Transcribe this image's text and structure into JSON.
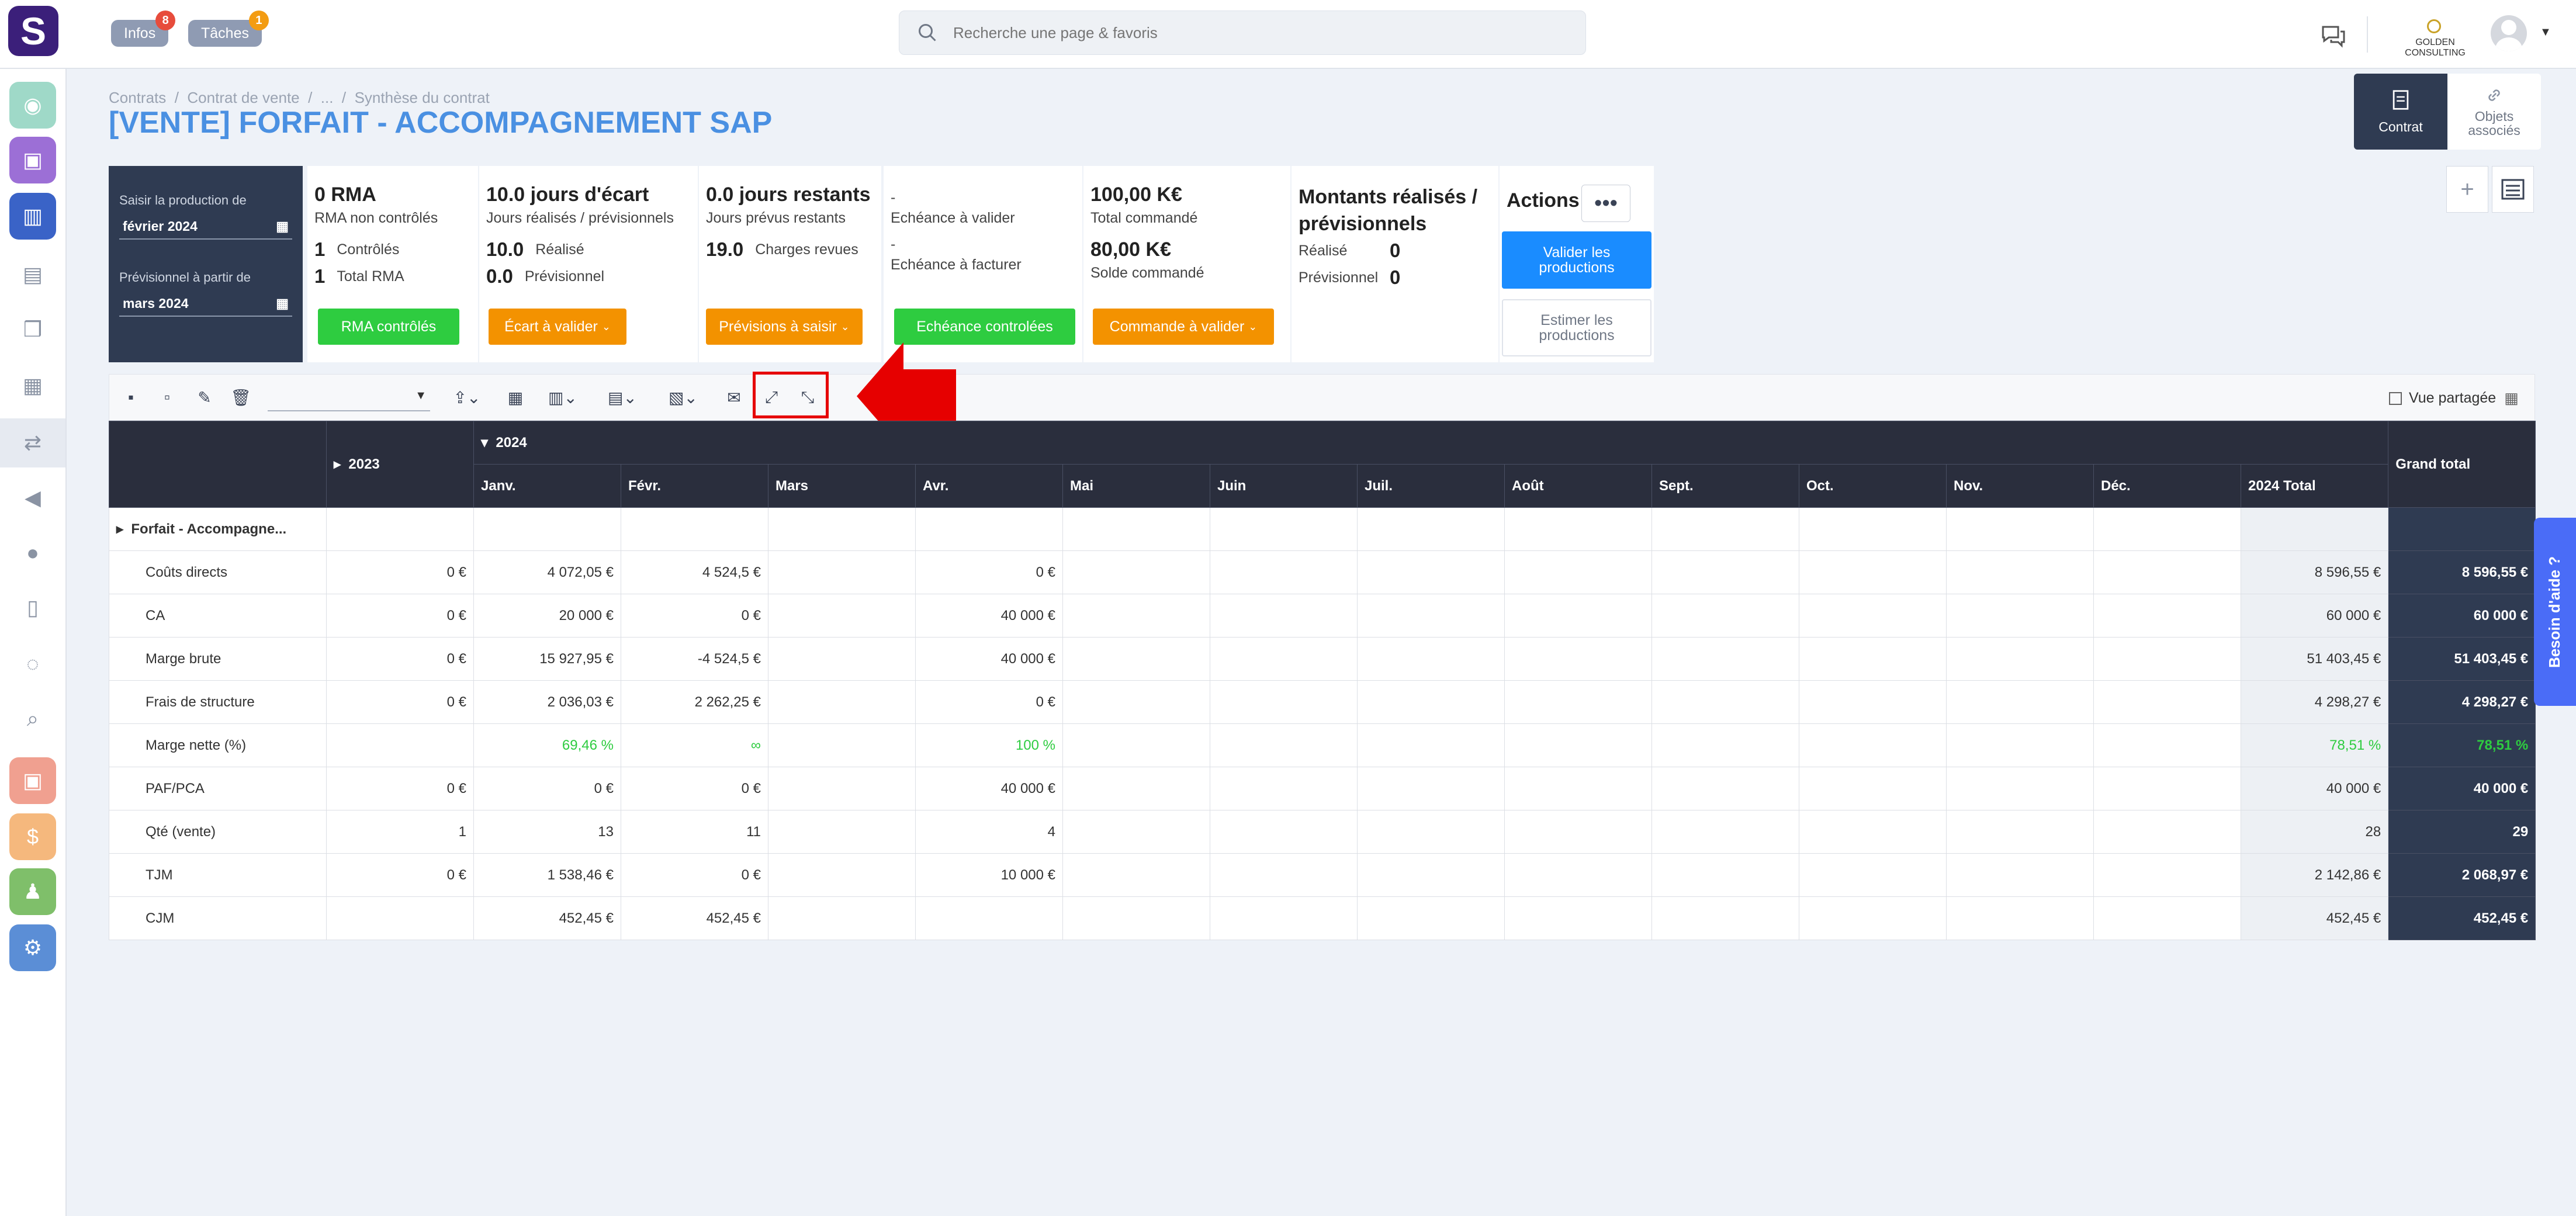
{
  "app": {
    "logo_letter": "S"
  },
  "topbar": {
    "infos_label": "Infos",
    "infos_count": "8",
    "taches_label": "Tâches",
    "taches_count": "1",
    "search_placeholder": "Recherche une page & favoris",
    "company": "GOLDEN CONSULTING"
  },
  "breadcrumb": [
    "Contrats",
    "/",
    "Contrat de vente",
    "/",
    "...",
    "/",
    "Synthèse du contrat"
  ],
  "page_title": "[VENTE] FORFAIT - ACCOMPAGNEMENT SAP",
  "view_tabs": {
    "contrat": "Contrat",
    "objets": "Objets associés"
  },
  "saisie": {
    "label1": "Saisir la production de",
    "value1": "février 2024",
    "label2": "Prévisionnel à partir de",
    "value2": "mars 2024"
  },
  "kpi": {
    "rma": {
      "title": "0 RMA",
      "sub": "RMA non contrôlés",
      "r1n": "1",
      "r1t": "Contrôlés",
      "r2n": "1",
      "r2t": "Total RMA",
      "btn": "RMA contrôlés"
    },
    "ecart": {
      "title": "10.0 jours d'écart",
      "sub": "Jours réalisés / prévisionnels",
      "r1n": "10.0",
      "r1t": "Réalisé",
      "r2n": "0.0",
      "r2t": "Prévisionnel",
      "btn": "Écart à valider"
    },
    "restants": {
      "title": "0.0 jours restants",
      "sub": "Jours prévus restants",
      "r1n": "19.0",
      "r1t": "Charges revues",
      "btn": "Prévisions à saisir"
    },
    "echeance": {
      "d1": "-",
      "l1": "Echéance à valider",
      "d2": "-",
      "l2": "Echéance à facturer",
      "btn": "Echéance controlées"
    },
    "commande": {
      "title": "100,00 K€",
      "sub": "Total commandé",
      "title2": "80,00 K€",
      "sub2": "Solde commandé",
      "btn": "Commande à valider"
    },
    "montants": {
      "title": "Montants réalisés / prévisionnels",
      "r1t": "Réalisé",
      "r1n": "0",
      "r2t": "Prévisionnel",
      "r2n": "0"
    },
    "actions": {
      "title": "Actions",
      "btn1": "Valider les productions",
      "btn2": "Estimer les productions"
    }
  },
  "toolbar": {
    "vue_partagee": "Vue partagée"
  },
  "table": {
    "year2023": "2023",
    "year2024": "2024",
    "months": [
      "Janv.",
      "Févr.",
      "Mars",
      "Avr.",
      "Mai",
      "Juin",
      "Juil.",
      "Août",
      "Sept.",
      "Oct.",
      "Nov.",
      "Déc."
    ],
    "total2024": "2024 Total",
    "grand_total": "Grand total",
    "group": "Forfait - Accompagne...",
    "rows": [
      {
        "label": "Coûts directs",
        "y2023": "0 €",
        "janv": "4 072,05 €",
        "fevr": "4 524,5 €",
        "mars": "",
        "avr": "0 €",
        "tot": "8 596,55 €",
        "gt": "8 596,55 €"
      },
      {
        "label": "CA",
        "y2023": "0 €",
        "janv": "20 000 €",
        "fevr": "0 €",
        "mars": "",
        "avr": "40 000 €",
        "tot": "60 000 €",
        "gt": "60 000 €"
      },
      {
        "label": "Marge brute",
        "y2023": "0 €",
        "janv": "15 927,95 €",
        "fevr": "-4 524,5 €",
        "mars": "",
        "avr": "40 000 €",
        "tot": "51 403,45 €",
        "gt": "51 403,45 €"
      },
      {
        "label": "Frais de structure",
        "y2023": "0 €",
        "janv": "2 036,03 €",
        "fevr": "2 262,25 €",
        "mars": "",
        "avr": "0 €",
        "tot": "4 298,27 €",
        "gt": "4 298,27 €"
      },
      {
        "label": "Marge nette (%)",
        "y2023": "",
        "janv": "69,46 %",
        "fevr": "∞",
        "mars": "",
        "avr": "100 %",
        "tot": "78,51 %",
        "gt": "78,51 %"
      },
      {
        "label": "PAF/PCA",
        "y2023": "0 €",
        "janv": "0 €",
        "fevr": "0 €",
        "mars": "",
        "avr": "40 000 €",
        "tot": "40 000 €",
        "gt": "40 000 €"
      },
      {
        "label": "Qté (vente)",
        "y2023": "1",
        "janv": "13",
        "fevr": "11",
        "mars": "",
        "avr": "4",
        "tot": "28",
        "gt": "29"
      },
      {
        "label": "TJM",
        "y2023": "0 €",
        "janv": "1 538,46 €",
        "fevr": "0 €",
        "mars": "",
        "avr": "10 000 €",
        "tot": "2 142,86 €",
        "gt": "2 068,97 €"
      },
      {
        "label": "CJM",
        "y2023": "",
        "janv": "452,45 €",
        "fevr": "452,45 €",
        "mars": "",
        "avr": "",
        "tot": "452,45 €",
        "gt": "452,45 €"
      }
    ]
  },
  "help": "Besoin d'aide ?",
  "colors": {
    "accent": "#4a90e2",
    "green": "#2ecc40",
    "orange": "#f39200",
    "blue": "#1a8cff",
    "dark": "#2f3b52",
    "highlight": "#e60000"
  }
}
